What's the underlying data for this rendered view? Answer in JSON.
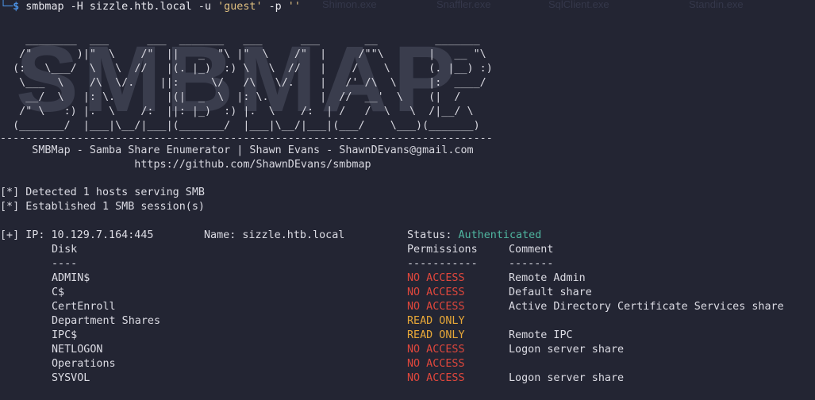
{
  "command": {
    "prompt_corner": "└─",
    "prompt_sign": "$",
    "program": "smbmap",
    "args_pre": " -H sizzle.htb.local -u ",
    "user_str": "'guest'",
    "args_mid": " -p ",
    "pass_str": "''"
  },
  "background_ghost": {
    "top_items": [
      "Shimon.exe",
      "Snaffler.exe",
      "SqlClient.exe",
      "Standin.exe"
    ],
    "logo": "SMBMAP"
  },
  "banner": {
    "art": [
      "    ________  ___      ___  _______   ___      ___       __         _______",
      "   /\"       )|\"  \\    /\"  ||   _  \"\\ |\"  \\    /\"  |     /\"\"\\       |   __ \"\\",
      "  (:   \\___/  \\   \\  //   |(. |_)  :) \\   \\  //   |    /    \\      (. |__) :)",
      "   \\___  \\    /\\  \\/.    ||:     \\/   /\\   \\/.    |   /' /\\  \\     |:  ____/",
      "    __/  \\   |: \\.        |(|  _  \\  |: \\.        |  //  __'  \\    (|  /",
      "   /\" \\   :) |.  \\    /:  ||: |_)  :) |.  \\    /:  | /   /  \\   \\  /|__/ \\",
      "  (_______/  |___|\\__/|___|(_______/  |___|\\__/|___|(___/    \\___)(_______)"
    ],
    "separator": "-----------------------------------------------------------------------------",
    "credit": "     SMBMap - Samba Share Enumerator | Shawn Evans - ShawnDEvans@gmail.com",
    "url": "                     https://github.com/ShawnDEvans/smbmap"
  },
  "status_lines": [
    "[*] Detected 1 hosts serving SMB",
    "[*] Established 1 SMB session(s)"
  ],
  "host": {
    "prefix": "[+] IP: ",
    "ip": "10.129.7.164:445",
    "name_label": "Name: ",
    "name": "sizzle.htb.local",
    "status_label": "Status: ",
    "status": "Authenticated"
  },
  "table": {
    "headers": {
      "disk": "Disk",
      "permissions": "Permissions",
      "comment": "Comment"
    },
    "underlines": {
      "disk": "----",
      "permissions": "-----------",
      "comment": "-------"
    },
    "rows": [
      {
        "disk": "ADMIN$",
        "permissions": "NO ACCESS",
        "comment": "Remote Admin",
        "kind": "no"
      },
      {
        "disk": "C$",
        "permissions": "NO ACCESS",
        "comment": "Default share",
        "kind": "no"
      },
      {
        "disk": "CertEnroll",
        "permissions": "NO ACCESS",
        "comment": "Active Directory Certificate Services share",
        "kind": "no"
      },
      {
        "disk": "Department Shares",
        "permissions": "READ ONLY",
        "comment": "",
        "kind": "ro"
      },
      {
        "disk": "IPC$",
        "permissions": "READ ONLY",
        "comment": "Remote IPC",
        "kind": "ro"
      },
      {
        "disk": "NETLOGON",
        "permissions": "NO ACCESS",
        "comment": "Logon server share",
        "kind": "no"
      },
      {
        "disk": "Operations",
        "permissions": "NO ACCESS",
        "comment": "",
        "kind": "no"
      },
      {
        "disk": "SYSVOL",
        "permissions": "NO ACCESS",
        "comment": "Logon server share",
        "kind": "no"
      }
    ]
  },
  "colors": {
    "background": "#232533",
    "prompt": "#4a90e2",
    "authenticated": "#4fb6a0",
    "no_access": "#e0473c",
    "read_only": "#e8a838"
  }
}
